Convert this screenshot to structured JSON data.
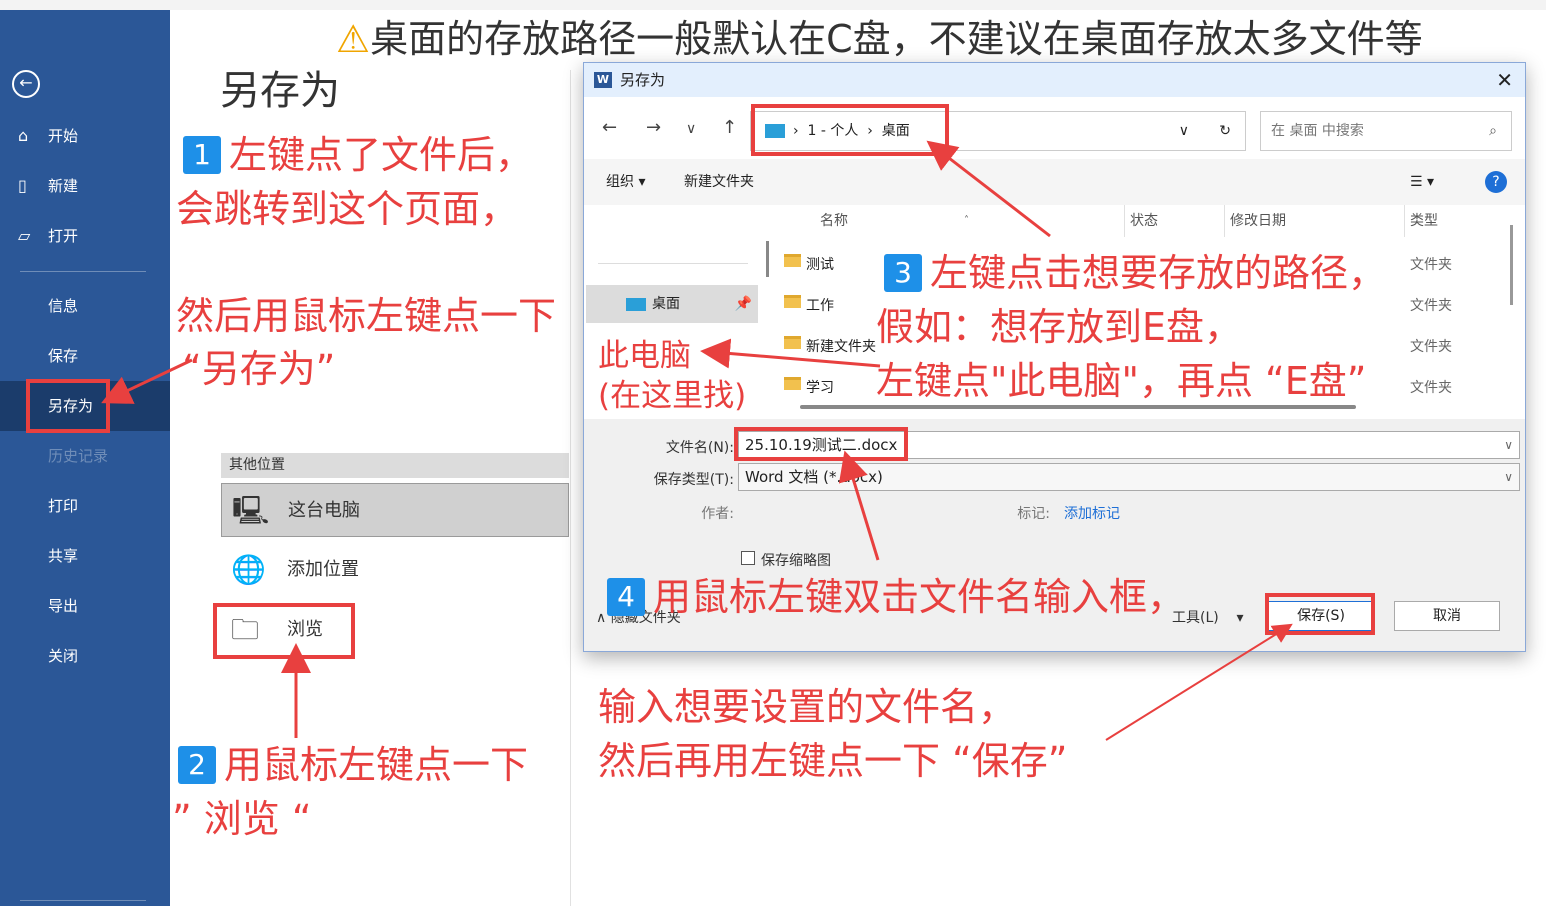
{
  "warning": "桌面的存放路径一般默认在C盘，不建议在桌面存放太多文件等",
  "sidebar": {
    "back_icon": "back-arrow-icon",
    "items": [
      {
        "label": "开始",
        "icon": "home-icon"
      },
      {
        "label": "新建",
        "icon": "new-file-icon"
      },
      {
        "label": "打开",
        "icon": "folder-open-icon"
      },
      {
        "label": "信息"
      },
      {
        "label": "保存"
      },
      {
        "label": "另存为"
      },
      {
        "label": "历史记录"
      },
      {
        "label": "打印"
      },
      {
        "label": "共享"
      },
      {
        "label": "导出"
      },
      {
        "label": "关闭"
      }
    ]
  },
  "main": {
    "title": "另存为",
    "other_locations_label": "其他位置",
    "locations": [
      {
        "label": "这台电脑",
        "icon": "this-pc-icon"
      },
      {
        "label": "添加位置",
        "icon": "add-location-icon"
      },
      {
        "label": "浏览",
        "icon": "browse-folder-icon"
      }
    ]
  },
  "dialog": {
    "title": "另存为",
    "address": {
      "part1": "1 - 个人",
      "part2": "桌面"
    },
    "search_placeholder": "在 桌面 中搜索",
    "toolbar": {
      "organize": "组织",
      "new_folder": "新建文件夹",
      "help": "?"
    },
    "tree": {
      "desktop": "桌面"
    },
    "columns": {
      "name": "名称",
      "status": "状态",
      "modified": "修改日期",
      "type": "类型"
    },
    "files": [
      {
        "name": "测试",
        "type": "文件夹"
      },
      {
        "name": "工作",
        "type": "文件夹"
      },
      {
        "name": "新建文件夹",
        "type": "文件夹"
      },
      {
        "name": "学习",
        "type": "文件夹"
      }
    ],
    "filename_label": "文件名(N):",
    "filename_value": "25.10.19测试二.docx",
    "filetype_label": "保存类型(T):",
    "filetype_value": "Word 文档 (*.docx)",
    "author_label": "作者:",
    "tags_label": "标记:",
    "tags_value": "添加标记",
    "thumbnail_label": "保存缩略图",
    "hide_folders": "隐藏文件夹",
    "tools": "工具(L)",
    "save": "保存(S)",
    "cancel": "取消"
  },
  "annotations": {
    "step1_num": "1",
    "step1_line1": "左键点了文件后，",
    "step1_line2": "会跳转到这个页面，",
    "step1_line3": "然后用鼠标左键点一下",
    "step1_line4": "“另存为”",
    "step2_num": "2",
    "step2_line1": "用鼠标左键点一下",
    "step2_line2": "” 浏览 “",
    "step3_num": "3",
    "step3_line1": "左键点击想要存放的路径，",
    "step3_line2": "假如：想存放到E盘，",
    "step3_line3": "左键点\"此电脑\"，再点 “E盘”",
    "pc_hint_line1": "此电脑",
    "pc_hint_line2": "(在这里找)",
    "step4_num": "4",
    "step4_line1": "用鼠标左键双击文件名输入框，",
    "step4_line2": "输入想要设置的文件名，",
    "step4_line3": "然后再用左键点一下 “保存”"
  }
}
